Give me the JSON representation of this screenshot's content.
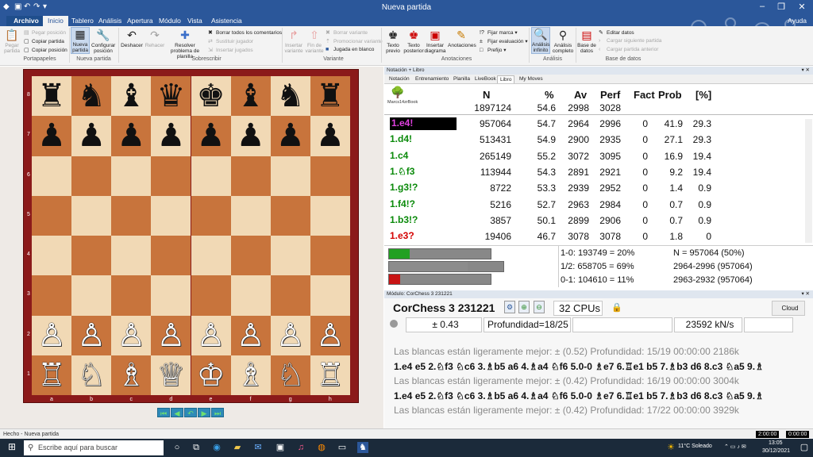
{
  "window": {
    "title": "Nueva partida"
  },
  "tabs": [
    "Archivo",
    "Inicio",
    "Tablero",
    "Análisis",
    "Apertura",
    "Módulo",
    "Vista",
    "Asistencia"
  ],
  "help_label": "Ayuda",
  "ribbon": {
    "paste_game": "Pegar partida",
    "paste_position": "Pegar posición",
    "copy_game": "Copiar partida",
    "copy_position": "Copiar posición",
    "new_game": "Nueva partida",
    "setup_position": "Configurar posición",
    "undo": "Deshacer",
    "redo": "Rehacer",
    "solve_problem": "Resolver problema de planilla",
    "delete_comments": "Borrar todos los comentarios",
    "replace_players": "Sustituir jugador",
    "insert_players": "Insertar jugados",
    "insert_variation": "Insertar variante",
    "end_variation": "Fin de variante",
    "delete_variation": "Borrar variante",
    "promote_variation": "Promocionar variante",
    "blank_move": "Jugada en blanco",
    "preview_text": "Texto previo",
    "post_text": "Texto posterior",
    "insert_diagram": "Insertar diagrama",
    "annotations_btn": "Anotaciones",
    "set_mark": "Fijar marca",
    "set_eval": "Fijar evaluación",
    "prefix": "Prefijo",
    "infinite_analysis": "Análisis infinito",
    "full_analysis": "Análisis completo",
    "database": "Base de datos",
    "edit_data": "Editar datos",
    "load_next": "Cargar siguiente partida",
    "load_prev": "Cargar partida anterior",
    "groups": {
      "clipboard": "Portapapeles",
      "new_game": "Nueva partida",
      "overwrite": "Sobrescribir",
      "variation": "Variante",
      "annotations": "Anotaciones",
      "analysis": "Análisis",
      "database": "Base de datos"
    }
  },
  "board": {
    "files": [
      "a",
      "b",
      "c",
      "d",
      "e",
      "f",
      "g",
      "h"
    ],
    "ranks": [
      "8",
      "7",
      "6",
      "5",
      "4",
      "3",
      "2",
      "1"
    ],
    "pieces": [
      [
        "♜",
        "♞",
        "♝",
        "♛",
        "♚",
        "♝",
        "♞",
        "♜"
      ],
      [
        "♟",
        "♟",
        "♟",
        "♟",
        "♟",
        "♟",
        "♟",
        "♟"
      ],
      [
        "",
        "",
        "",
        "",
        "",
        "",
        "",
        ""
      ],
      [
        "",
        "",
        "",
        "",
        "",
        "",
        "",
        ""
      ],
      [
        "",
        "",
        "",
        "",
        "",
        "",
        "",
        ""
      ],
      [
        "",
        "",
        "",
        "",
        "",
        "",
        "",
        ""
      ],
      [
        "♙",
        "♙",
        "♙",
        "♙",
        "♙",
        "♙",
        "♙",
        "♙"
      ],
      [
        "♖",
        "♘",
        "♗",
        "♕",
        "♔",
        "♗",
        "♘",
        "♖"
      ]
    ],
    "light_color": "#f1d9b5",
    "dark_color": "#c8743c",
    "frame_color": "#8b1a1a"
  },
  "notation": {
    "header": "Notación + Libro",
    "tabs": [
      "Notación",
      "Entrenamiento",
      "Planilla",
      "LiveBook",
      "Libro",
      "My Moves"
    ],
    "active_tab": "Libro"
  },
  "book": {
    "name": "Marcs14zrBook",
    "headers": [
      "N",
      "%",
      "Av",
      "Perf",
      "Fact",
      "Prob",
      "[%]"
    ],
    "total": {
      "n": "1897124",
      "pct": "54.6",
      "av": "2998",
      "perf": "3028"
    },
    "rows": [
      {
        "move": "1.e4!",
        "n": "957064",
        "pct": "54.7",
        "av": "2964",
        "perf": "2996",
        "fact": "0",
        "prob": "41.9",
        "share": "29.3"
      },
      {
        "move": "1.d4!",
        "n": "513431",
        "pct": "54.9",
        "av": "2900",
        "perf": "2935",
        "fact": "0",
        "prob": "27.1",
        "share": "29.3"
      },
      {
        "move": "1.c4",
        "n": "265149",
        "pct": "55.2",
        "av": "3072",
        "perf": "3095",
        "fact": "0",
        "prob": "16.9",
        "share": "19.4"
      },
      {
        "move": "1.♘f3",
        "n": "113944",
        "pct": "54.3",
        "av": "2891",
        "perf": "2921",
        "fact": "0",
        "prob": "9.2",
        "share": "19.4"
      },
      {
        "move": "1.g3!?",
        "n": "8722",
        "pct": "53.3",
        "av": "2939",
        "perf": "2952",
        "fact": "0",
        "prob": "1.4",
        "share": "0.9"
      },
      {
        "move": "1.f4!?",
        "n": "5216",
        "pct": "52.7",
        "av": "2963",
        "perf": "2984",
        "fact": "0",
        "prob": "0.7",
        "share": "0.9"
      },
      {
        "move": "1.b3!?",
        "n": "3857",
        "pct": "50.1",
        "av": "2899",
        "perf": "2906",
        "fact": "0",
        "prob": "0.7",
        "share": "0.9"
      },
      {
        "move": "1.e3?",
        "n": "19406",
        "pct": "46.7",
        "av": "3078",
        "perf": "3078",
        "fact": "0",
        "prob": "1.8",
        "share": "0"
      }
    ],
    "stats": {
      "white_win": "1-0:  193749 = 20%",
      "draw": "1/2:  658705 = 69%",
      "black_win": "0-1:  104610 = 11%",
      "n_line": "N = 957064 (50%)",
      "perf_white": "2964-2996 (957064)",
      "perf_black": "2963-2932 (957064)",
      "bar_fractions": [
        0.2,
        0.69,
        0.11
      ],
      "bar_colors": [
        "#22a022",
        "#8c8c8c",
        "#c81414"
      ]
    }
  },
  "engine": {
    "header": "Módulo: CorChess 3 231221",
    "name": "CorChess 3 231221",
    "cpus": "32 CPUs",
    "cloud": "Cloud",
    "eval": "± 0.43",
    "depth": "Profundidad=18/25",
    "speed": "23592 kN/s",
    "lines": [
      {
        "kind": "info",
        "text": "Las blancas están ligeramente mejor: ± (0.52)  Profundidad: 15/19   00:00:00  2186k"
      },
      {
        "kind": "pv",
        "text": "1.e4 e5 2.♘f3 ♘c6 3.♗b5 a6 4.♗a4 ♘f6 5.0-0 ♗e7 6.♖e1 b5 7.♗b3 d6 8.c3 ♘a5 9.♗"
      },
      {
        "kind": "info",
        "text": "Las blancas están ligeramente mejor: ± (0.42)  Profundidad: 16/19   00:00:00  3004k"
      },
      {
        "kind": "pv",
        "text": "1.e4 e5 2.♘f3 ♘c6 3.♗b5 a6 4.♗a4 ♘f6 5.0-0 ♗e7 6.♖e1 b5 7.♗b3 d6 8.c3 ♘a5 9.♗"
      },
      {
        "kind": "info",
        "text": "Las blancas están ligeramente mejor: ± (0.42)  Profundidad: 17/22   00:00:00  3929k"
      }
    ]
  },
  "status": {
    "text": "Hecho - Nueva partida",
    "clock_white": "2:00:00",
    "clock_black": "0:00:00"
  },
  "taskbar": {
    "search_placeholder": "Escribe aquí para buscar",
    "weather": "11°C  Soleado",
    "time": "13:05",
    "date": "30/12/2021"
  }
}
